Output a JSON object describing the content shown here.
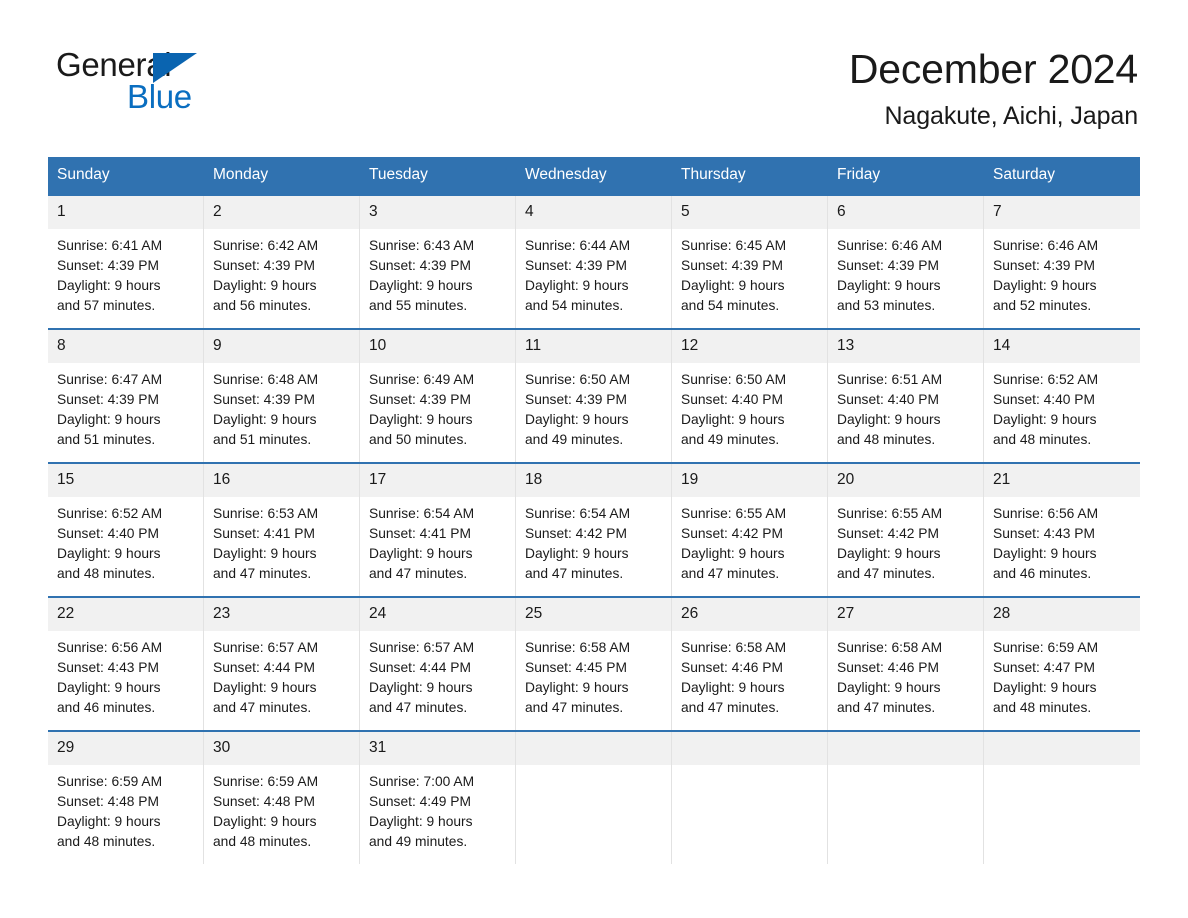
{
  "brand": {
    "logo_word_1": "General",
    "logo_word_2": "Blue",
    "logo_icon": "triangle-icon",
    "accent_blue": "#0a6ec0",
    "header_blue": "#3072b0",
    "date_row_gray": "#f1f1f1"
  },
  "header": {
    "month_title": "December 2024",
    "location": "Nagakute, Aichi, Japan"
  },
  "weekdays": [
    "Sunday",
    "Monday",
    "Tuesday",
    "Wednesday",
    "Thursday",
    "Friday",
    "Saturday"
  ],
  "weeks": [
    {
      "days": [
        {
          "date": "1",
          "sunrise": "Sunrise: 6:41 AM",
          "sunset": "Sunset: 4:39 PM",
          "daylight_1": "Daylight: 9 hours",
          "daylight_2": "and 57 minutes."
        },
        {
          "date": "2",
          "sunrise": "Sunrise: 6:42 AM",
          "sunset": "Sunset: 4:39 PM",
          "daylight_1": "Daylight: 9 hours",
          "daylight_2": "and 56 minutes."
        },
        {
          "date": "3",
          "sunrise": "Sunrise: 6:43 AM",
          "sunset": "Sunset: 4:39 PM",
          "daylight_1": "Daylight: 9 hours",
          "daylight_2": "and 55 minutes."
        },
        {
          "date": "4",
          "sunrise": "Sunrise: 6:44 AM",
          "sunset": "Sunset: 4:39 PM",
          "daylight_1": "Daylight: 9 hours",
          "daylight_2": "and 54 minutes."
        },
        {
          "date": "5",
          "sunrise": "Sunrise: 6:45 AM",
          "sunset": "Sunset: 4:39 PM",
          "daylight_1": "Daylight: 9 hours",
          "daylight_2": "and 54 minutes."
        },
        {
          "date": "6",
          "sunrise": "Sunrise: 6:46 AM",
          "sunset": "Sunset: 4:39 PM",
          "daylight_1": "Daylight: 9 hours",
          "daylight_2": "and 53 minutes."
        },
        {
          "date": "7",
          "sunrise": "Sunrise: 6:46 AM",
          "sunset": "Sunset: 4:39 PM",
          "daylight_1": "Daylight: 9 hours",
          "daylight_2": "and 52 minutes."
        }
      ]
    },
    {
      "days": [
        {
          "date": "8",
          "sunrise": "Sunrise: 6:47 AM",
          "sunset": "Sunset: 4:39 PM",
          "daylight_1": "Daylight: 9 hours",
          "daylight_2": "and 51 minutes."
        },
        {
          "date": "9",
          "sunrise": "Sunrise: 6:48 AM",
          "sunset": "Sunset: 4:39 PM",
          "daylight_1": "Daylight: 9 hours",
          "daylight_2": "and 51 minutes."
        },
        {
          "date": "10",
          "sunrise": "Sunrise: 6:49 AM",
          "sunset": "Sunset: 4:39 PM",
          "daylight_1": "Daylight: 9 hours",
          "daylight_2": "and 50 minutes."
        },
        {
          "date": "11",
          "sunrise": "Sunrise: 6:50 AM",
          "sunset": "Sunset: 4:39 PM",
          "daylight_1": "Daylight: 9 hours",
          "daylight_2": "and 49 minutes."
        },
        {
          "date": "12",
          "sunrise": "Sunrise: 6:50 AM",
          "sunset": "Sunset: 4:40 PM",
          "daylight_1": "Daylight: 9 hours",
          "daylight_2": "and 49 minutes."
        },
        {
          "date": "13",
          "sunrise": "Sunrise: 6:51 AM",
          "sunset": "Sunset: 4:40 PM",
          "daylight_1": "Daylight: 9 hours",
          "daylight_2": "and 48 minutes."
        },
        {
          "date": "14",
          "sunrise": "Sunrise: 6:52 AM",
          "sunset": "Sunset: 4:40 PM",
          "daylight_1": "Daylight: 9 hours",
          "daylight_2": "and 48 minutes."
        }
      ]
    },
    {
      "days": [
        {
          "date": "15",
          "sunrise": "Sunrise: 6:52 AM",
          "sunset": "Sunset: 4:40 PM",
          "daylight_1": "Daylight: 9 hours",
          "daylight_2": "and 48 minutes."
        },
        {
          "date": "16",
          "sunrise": "Sunrise: 6:53 AM",
          "sunset": "Sunset: 4:41 PM",
          "daylight_1": "Daylight: 9 hours",
          "daylight_2": "and 47 minutes."
        },
        {
          "date": "17",
          "sunrise": "Sunrise: 6:54 AM",
          "sunset": "Sunset: 4:41 PM",
          "daylight_1": "Daylight: 9 hours",
          "daylight_2": "and 47 minutes."
        },
        {
          "date": "18",
          "sunrise": "Sunrise: 6:54 AM",
          "sunset": "Sunset: 4:42 PM",
          "daylight_1": "Daylight: 9 hours",
          "daylight_2": "and 47 minutes."
        },
        {
          "date": "19",
          "sunrise": "Sunrise: 6:55 AM",
          "sunset": "Sunset: 4:42 PM",
          "daylight_1": "Daylight: 9 hours",
          "daylight_2": "and 47 minutes."
        },
        {
          "date": "20",
          "sunrise": "Sunrise: 6:55 AM",
          "sunset": "Sunset: 4:42 PM",
          "daylight_1": "Daylight: 9 hours",
          "daylight_2": "and 47 minutes."
        },
        {
          "date": "21",
          "sunrise": "Sunrise: 6:56 AM",
          "sunset": "Sunset: 4:43 PM",
          "daylight_1": "Daylight: 9 hours",
          "daylight_2": "and 46 minutes."
        }
      ]
    },
    {
      "days": [
        {
          "date": "22",
          "sunrise": "Sunrise: 6:56 AM",
          "sunset": "Sunset: 4:43 PM",
          "daylight_1": "Daylight: 9 hours",
          "daylight_2": "and 46 minutes."
        },
        {
          "date": "23",
          "sunrise": "Sunrise: 6:57 AM",
          "sunset": "Sunset: 4:44 PM",
          "daylight_1": "Daylight: 9 hours",
          "daylight_2": "and 47 minutes."
        },
        {
          "date": "24",
          "sunrise": "Sunrise: 6:57 AM",
          "sunset": "Sunset: 4:44 PM",
          "daylight_1": "Daylight: 9 hours",
          "daylight_2": "and 47 minutes."
        },
        {
          "date": "25",
          "sunrise": "Sunrise: 6:58 AM",
          "sunset": "Sunset: 4:45 PM",
          "daylight_1": "Daylight: 9 hours",
          "daylight_2": "and 47 minutes."
        },
        {
          "date": "26",
          "sunrise": "Sunrise: 6:58 AM",
          "sunset": "Sunset: 4:46 PM",
          "daylight_1": "Daylight: 9 hours",
          "daylight_2": "and 47 minutes."
        },
        {
          "date": "27",
          "sunrise": "Sunrise: 6:58 AM",
          "sunset": "Sunset: 4:46 PM",
          "daylight_1": "Daylight: 9 hours",
          "daylight_2": "and 47 minutes."
        },
        {
          "date": "28",
          "sunrise": "Sunrise: 6:59 AM",
          "sunset": "Sunset: 4:47 PM",
          "daylight_1": "Daylight: 9 hours",
          "daylight_2": "and 48 minutes."
        }
      ]
    },
    {
      "days": [
        {
          "date": "29",
          "sunrise": "Sunrise: 6:59 AM",
          "sunset": "Sunset: 4:48 PM",
          "daylight_1": "Daylight: 9 hours",
          "daylight_2": "and 48 minutes."
        },
        {
          "date": "30",
          "sunrise": "Sunrise: 6:59 AM",
          "sunset": "Sunset: 4:48 PM",
          "daylight_1": "Daylight: 9 hours",
          "daylight_2": "and 48 minutes."
        },
        {
          "date": "31",
          "sunrise": "Sunrise: 7:00 AM",
          "sunset": "Sunset: 4:49 PM",
          "daylight_1": "Daylight: 9 hours",
          "daylight_2": "and 49 minutes."
        },
        {
          "date": "",
          "sunrise": "",
          "sunset": "",
          "daylight_1": "",
          "daylight_2": ""
        },
        {
          "date": "",
          "sunrise": "",
          "sunset": "",
          "daylight_1": "",
          "daylight_2": ""
        },
        {
          "date": "",
          "sunrise": "",
          "sunset": "",
          "daylight_1": "",
          "daylight_2": ""
        },
        {
          "date": "",
          "sunrise": "",
          "sunset": "",
          "daylight_1": "",
          "daylight_2": ""
        }
      ]
    }
  ]
}
